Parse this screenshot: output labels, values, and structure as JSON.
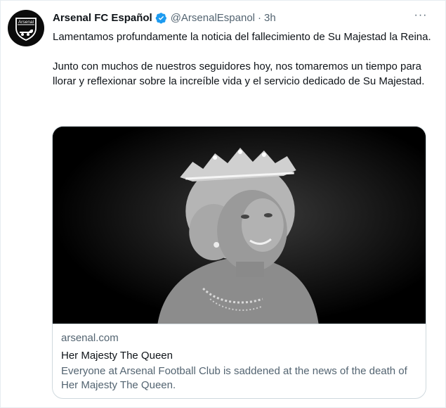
{
  "tweet": {
    "author_name": "Arsenal FC Español",
    "handle": "@ArsenalEspanol",
    "separator": "·",
    "time": "3h",
    "more_label": "···",
    "avatar_text": "Arsenal",
    "paragraphs": [
      "Lamentamos profundamente la noticia del fallecimiento de Su Majestad la Reina.",
      "Junto con muchos de nuestros seguidores hoy, nos tomaremos un tiempo para llorar y reflexionar sobre la increíble vida y el servicio dedicado de Su Majestad."
    ]
  },
  "card": {
    "domain": "arsenal.com",
    "title": "Her Majesty The Queen",
    "description": "Everyone at Arsenal Football Club is saddened at the news of the death of Her Majesty The Queen."
  },
  "colors": {
    "verified": "#1d9bf0",
    "secondary_text": "#536471",
    "border": "#cfd9de"
  },
  "icons": {
    "avatar": "arsenal-crest-icon",
    "verified": "verified-badge-icon",
    "more": "more-options-icon"
  }
}
